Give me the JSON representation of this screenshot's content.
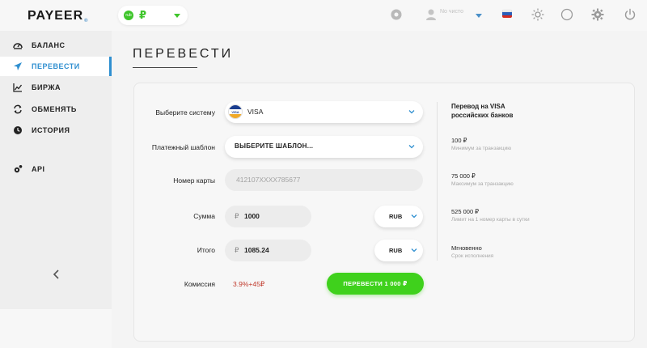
{
  "header": {
    "logo": "PAYEER",
    "logo_sup": "®",
    "wallet_currency": "₽",
    "wallet_badge": "rub",
    "user_text": "No чисто"
  },
  "sidebar": {
    "items": [
      {
        "label": "БАЛАНС",
        "icon": "gauge-icon"
      },
      {
        "label": "ПЕРЕВЕСТИ",
        "icon": "send-icon"
      },
      {
        "label": "БИРЖА",
        "icon": "chart-icon"
      },
      {
        "label": "ОБМЕНЯТЬ",
        "icon": "exchange-icon"
      },
      {
        "label": "ИСТОРИЯ",
        "icon": "clock-icon"
      },
      {
        "label": "API",
        "icon": "api-icon"
      }
    ],
    "active_index": 1,
    "collapse_label": "‹"
  },
  "page": {
    "title": "ПЕРЕВЕСТИ"
  },
  "form": {
    "system_label": "Выберите систему",
    "system_value": "VISA",
    "system_logo_text": "VISA",
    "template_label": "Платежный шаблон",
    "template_value": "ВЫБЕРИТЕ ШАБЛОН...",
    "card_label": "Номер карты",
    "card_value": "412107XXXX785677",
    "sum_label": "Сумма",
    "sum_sign": "₽",
    "sum_value": "1000",
    "sum_currency": "RUB",
    "total_label": "Итого",
    "total_sign": "₽",
    "total_value": "1085.24",
    "total_currency": "RUB",
    "fee_label": "Комиссия",
    "fee_value": "3.9%+45₽",
    "submit_label": "ПЕРЕВЕСТИ 1 000 ₽"
  },
  "info": {
    "title": "Перевод на VISA российских банков",
    "items": [
      {
        "value": "100 ₽",
        "sub": "Минимум за транзакцию"
      },
      {
        "value": "75 000 ₽",
        "sub": "Максимум за транзакцию"
      },
      {
        "value": "525 000 ₽",
        "sub": "Лимит на 1 номер карты в сутки"
      },
      {
        "value": "Мгновенно",
        "sub": "Срок исполнения"
      }
    ]
  },
  "colors": {
    "accent_blue": "#2f8fd0",
    "accent_green": "#3fd11c",
    "fee_red": "#c0392b"
  }
}
